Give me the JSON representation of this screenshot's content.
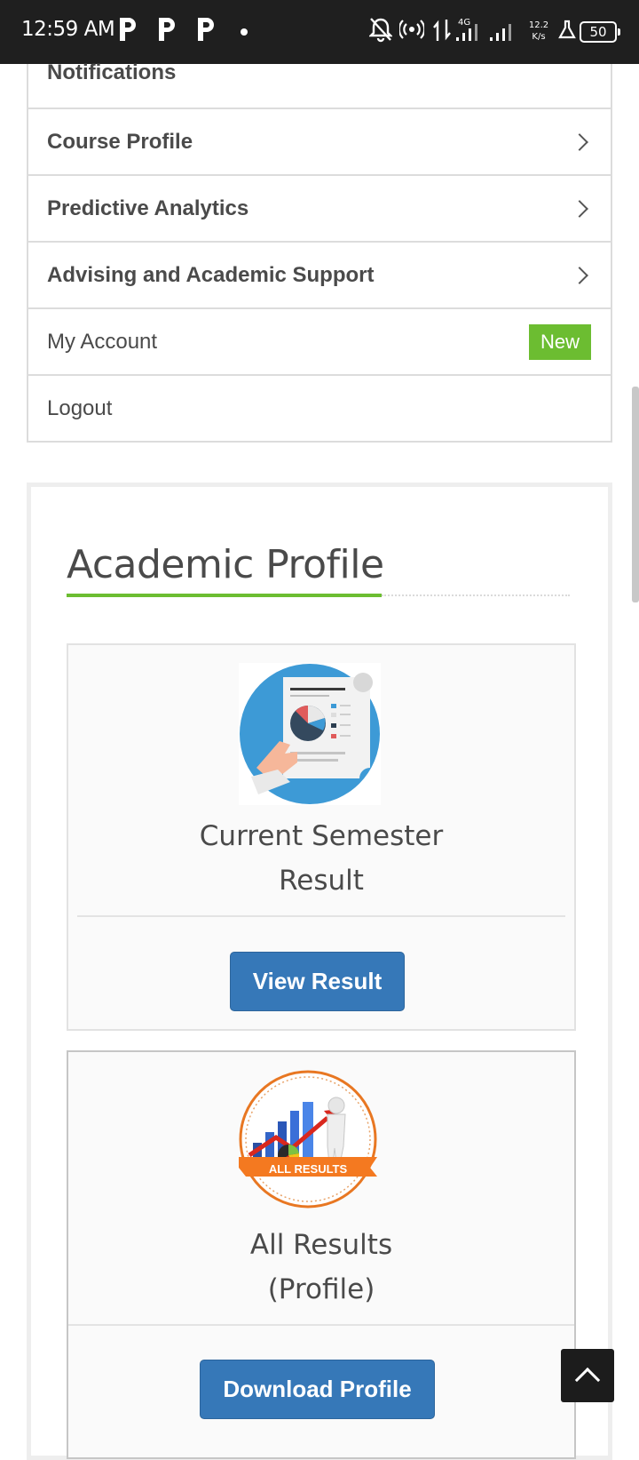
{
  "status_bar": {
    "time": "12:59 AM",
    "notification_icons": [
      "p-app-icon",
      "p-app-icon",
      "p-app-icon"
    ],
    "network_type": "4G",
    "speed_value": "12.2",
    "speed_unit": "K/s",
    "battery": "50"
  },
  "menu": {
    "items": [
      {
        "label": "Notifications",
        "bold": true
      },
      {
        "label": "Course Profile",
        "bold": true,
        "chevron": true
      },
      {
        "label": "Predictive Analytics",
        "bold": true,
        "chevron": true
      },
      {
        "label": "Advising and Academic Support",
        "bold": true,
        "chevron": true
      },
      {
        "label": "My Account",
        "bold": false,
        "badge": "New"
      },
      {
        "label": "Logout",
        "bold": false
      }
    ]
  },
  "colors": {
    "accent_green": "#6cbd31",
    "button_blue": "#3678b8",
    "text_gray": "#4a4a4a"
  },
  "academic_profile": {
    "title": "Academic Profile",
    "cards": [
      {
        "caption_line1": "Current Semester",
        "caption_line2": "Result",
        "button": "View Result",
        "image": "report-chart-illustration"
      },
      {
        "caption_line1": "All Results",
        "caption_line2": "(Profile)",
        "button": "Download Profile",
        "image_label": "ALL RESULTS"
      }
    ]
  }
}
